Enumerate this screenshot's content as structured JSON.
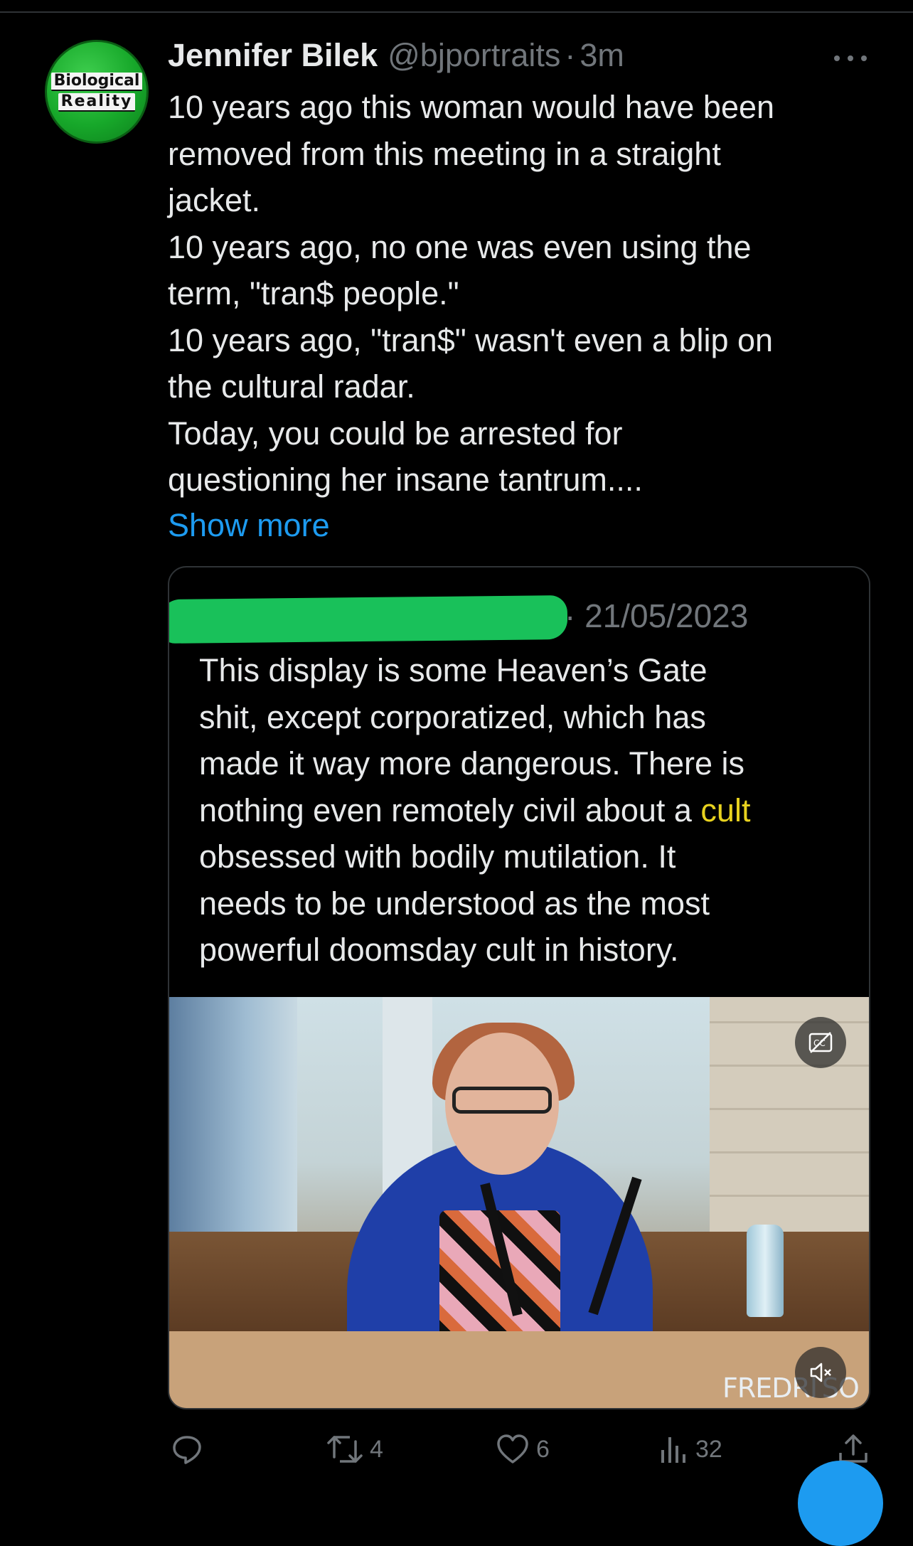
{
  "tweet": {
    "avatar_text_line1": "Biological",
    "avatar_text_line2": "Reality",
    "author_name": "Jennifer Bilek",
    "handle": "@bjportraits",
    "separator": "·",
    "time": "3m",
    "lines": [
      "10 years ago this woman would have been",
      "removed from this meeting in a straight",
      "jacket.",
      "10 years ago, no one was even using the",
      "term, \"tran$ people.\"",
      "10 years ago, \"tran$\" wasn't even a blip on",
      "the cultural radar.",
      "Today, you could be arrested for",
      "questioning her insane tantrum...."
    ],
    "show_more": "Show more"
  },
  "quote": {
    "date": "· 21/05/2023",
    "text_lines": [
      "This display is some Heaven’s Gate",
      "shit, except corporatized, which has",
      "made it way more dangerous. There is"
    ],
    "line4_before": "nothing even remotely civil about a ",
    "line4_highlight": "cult",
    "text_lines_after": [
      "obsessed with bodily mutilation. It",
      "needs to be understood as the most",
      "powerful doomsday cult in history."
    ],
    "highlight_color": "#e8d21f",
    "video": {
      "caption_overlay": "FREDRI SO",
      "cc_icon": "closed-captions-icon",
      "mute_icon": "muted-speaker-icon"
    }
  },
  "actions": {
    "reply_count": "",
    "retweet_count": "4",
    "like_count": "6",
    "views_count": "32"
  },
  "colors": {
    "background": "#000000",
    "text": "#e7e9ea",
    "muted": "#71767b",
    "link": "#1d9bf0",
    "redaction": "#19c15a"
  }
}
